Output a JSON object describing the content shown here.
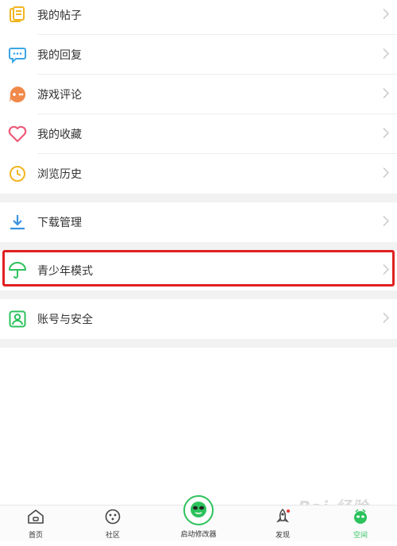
{
  "menu_group_1": {
    "items": [
      {
        "label": "我的帖子",
        "icon": "posts-icon"
      },
      {
        "label": "我的回复",
        "icon": "reply-icon"
      },
      {
        "label": "游戏评论",
        "icon": "game-review-icon"
      },
      {
        "label": "我的收藏",
        "icon": "favorites-heart-icon"
      },
      {
        "label": "浏览历史",
        "icon": "history-clock-icon"
      }
    ]
  },
  "menu_group_2": {
    "items": [
      {
        "label": "下载管理",
        "icon": "download-icon"
      }
    ]
  },
  "menu_group_3": {
    "items": [
      {
        "label": "青少年模式",
        "icon": "umbrella-icon",
        "highlighted": true
      }
    ]
  },
  "menu_group_4": {
    "items": [
      {
        "label": "账号与安全",
        "icon": "account-security-icon"
      }
    ]
  },
  "tabbar": {
    "tabs": [
      {
        "label": "首页",
        "icon": "home-icon"
      },
      {
        "label": "社区",
        "icon": "community-icon"
      },
      {
        "label": "启动修改器",
        "icon": "launch-modifier-icon"
      },
      {
        "label": "发现",
        "icon": "rocket-discover-icon"
      },
      {
        "label": "空间",
        "icon": "space-icon",
        "active": true
      }
    ]
  },
  "watermark": "Bai 经验",
  "colors": {
    "accent_green": "#2cc25c",
    "highlight_red": "#e02020",
    "posts_yellow": "#f2b520",
    "reply_blue": "#3aa7e6",
    "game_orange": "#f0894a",
    "heart_pink": "#ee5a78",
    "clock_yellow": "#f2b520",
    "download_blue": "#3b93e0",
    "umbrella_green": "#2cc25c",
    "account_green": "#2cc25c"
  }
}
